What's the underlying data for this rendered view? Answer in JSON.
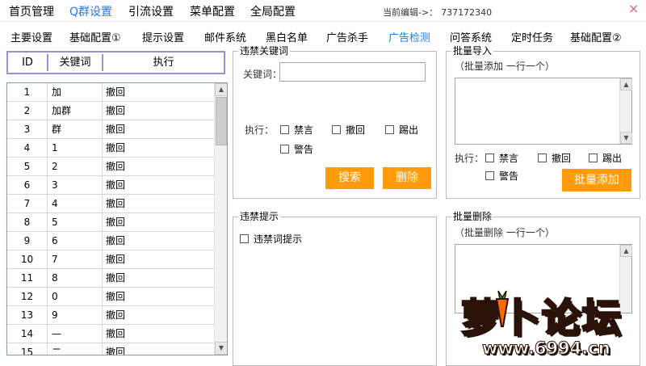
{
  "top_menu": {
    "items": [
      {
        "label": "首页管理"
      },
      {
        "label": "Q群设置"
      },
      {
        "label": "引流设置"
      },
      {
        "label": "菜单配置"
      },
      {
        "label": "全局配置"
      }
    ],
    "editing_label": "当前编辑->：",
    "editing_value": "737172340",
    "close": "×"
  },
  "sub_tabs": [
    {
      "label": "主要设置"
    },
    {
      "label": "基础配置①"
    },
    {
      "label": "提示设置"
    },
    {
      "label": "邮件系统"
    },
    {
      "label": "黑白名单"
    },
    {
      "label": "广告杀手"
    },
    {
      "label": "广告检测"
    },
    {
      "label": "问答系统"
    },
    {
      "label": "定时任务"
    },
    {
      "label": "基础配置②"
    }
  ],
  "list": {
    "headers": {
      "id": "ID",
      "keyword": "关键词",
      "action": "执行"
    },
    "rows": [
      {
        "id": "1",
        "keyword": "加",
        "action": "撤回"
      },
      {
        "id": "2",
        "keyword": "加群",
        "action": "撤回"
      },
      {
        "id": "3",
        "keyword": "群",
        "action": "撤回"
      },
      {
        "id": "4",
        "keyword": "1",
        "action": "撤回"
      },
      {
        "id": "5",
        "keyword": "2",
        "action": "撤回"
      },
      {
        "id": "6",
        "keyword": "3",
        "action": "撤回"
      },
      {
        "id": "7",
        "keyword": "4",
        "action": "撤回"
      },
      {
        "id": "8",
        "keyword": "5",
        "action": "撤回"
      },
      {
        "id": "9",
        "keyword": "6",
        "action": "撤回"
      },
      {
        "id": "10",
        "keyword": "7",
        "action": "撤回"
      },
      {
        "id": "11",
        "keyword": "8",
        "action": "撤回"
      },
      {
        "id": "12",
        "keyword": "0",
        "action": "撤回"
      },
      {
        "id": "13",
        "keyword": "9",
        "action": "撤回"
      },
      {
        "id": "14",
        "keyword": "—",
        "action": "撤回"
      },
      {
        "id": "15",
        "keyword": "二",
        "action": "撤回"
      }
    ]
  },
  "keyword_group": {
    "title": "违禁关键词",
    "keyword_label": "关键词：",
    "keyword_value": "",
    "action_label": "执行：",
    "options": [
      "禁言",
      "撤回",
      "踢出",
      "警告"
    ],
    "search_button": "搜索",
    "delete_button": "删除"
  },
  "batch_import": {
    "title": "批量导入",
    "hint": "（批量添加 一行一个）",
    "action_label": "执行：",
    "options": [
      "禁言",
      "撤回",
      "踢出",
      "警告"
    ],
    "add_button": "批量添加"
  },
  "prompt_group": {
    "title": "违禁提示",
    "checkbox_label": "违禁词提示"
  },
  "batch_delete": {
    "title": "批量删除",
    "hint": "（批量删除 一行一个）"
  },
  "watermark": {
    "text": "萝卜论坛",
    "url": "www.6994.cn"
  },
  "colors": {
    "accent": "#1a7cf0",
    "button": "#ff9b0c",
    "header_border": "#9a8fd6"
  },
  "icons": {
    "scroll_up": "scroll-up-arrow-icon",
    "scroll_down": "scroll-down-arrow-icon",
    "close": "close-icon"
  }
}
